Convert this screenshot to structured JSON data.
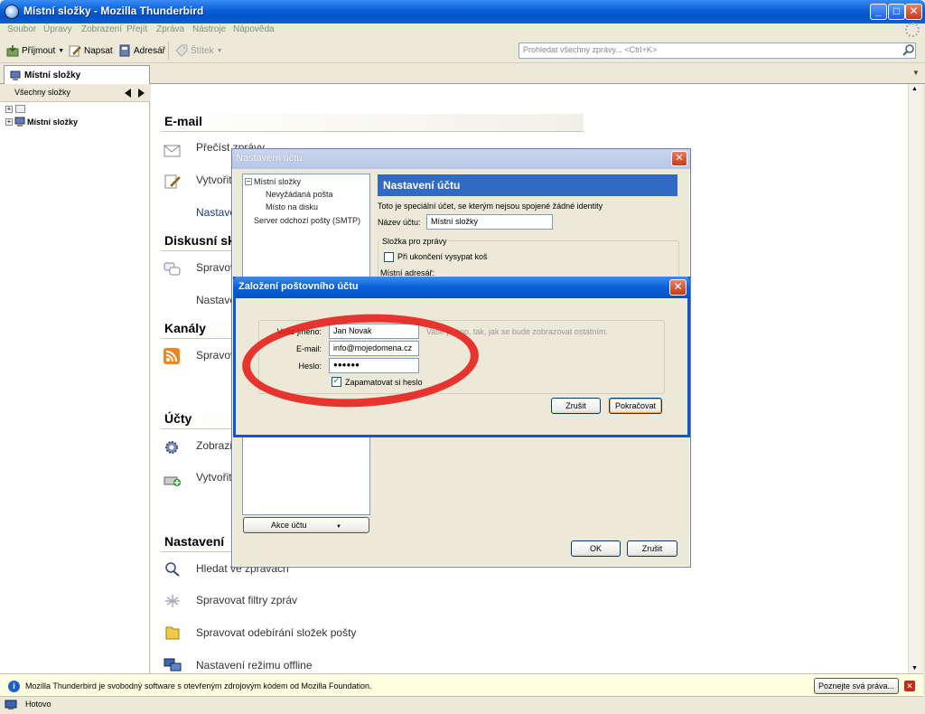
{
  "window": {
    "title": "Místní složky - Mozilla Thunderbird"
  },
  "menu": [
    "Soubor",
    "Úpravy",
    "Zobrazení",
    "Přejít",
    "Zpráva",
    "Nástroje",
    "Nápověda"
  ],
  "toolbar": {
    "get_mail": "Příjmout",
    "write": "Napsat",
    "address_book": "Adresář",
    "tag": "Štítek"
  },
  "search": {
    "placeholder": "Prohledat všechny zprávy... <Ctrl+K>"
  },
  "tab": {
    "label": "Místní složky"
  },
  "folder_pane": {
    "header": "Všechny složky",
    "root": "Místní složky"
  },
  "main": {
    "email_title": "E-mail",
    "email_items": [
      "Přečíst zprávy",
      "Vytvořit",
      "Nastave"
    ],
    "news_title": "Diskusní sk",
    "news_items": [
      "Spravov",
      "Nastave"
    ],
    "feeds_title": "Kanály",
    "feeds_items": [
      "Spravov"
    ],
    "accounts_title": "Účty",
    "accounts_items": [
      "Zobrazit",
      "Vytvořit"
    ],
    "settings_title": "Nastavení",
    "settings_items": [
      "Hledat ve zprávách",
      "Spravovat filtry zpráv",
      "Spravovat odebírání složek pošty",
      "Nastavení režimu offline"
    ]
  },
  "account_settings": {
    "title": "Nastavení účtu",
    "tree": [
      "Místní složky",
      "Nevyžádaná pošta",
      "Místo na disku",
      "Server odchozí pošty (SMTP)"
    ],
    "header": "Nastavení účtu",
    "description": "Toto je speciální účet, se kterým nejsou spojené žádné identity",
    "account_name_label": "Název účtu:",
    "account_name_value": "Místní složky",
    "message_storage_legend": "Složka pro zprávy",
    "empty_trash_label": "Při ukončení vysypat koš",
    "local_dir_label": "Místní adresář:",
    "account_actions": "Akce účtu",
    "ok": "OK",
    "cancel": "Zrušit"
  },
  "new_account": {
    "title": "Založení poštovního účtu",
    "name_label": "Vaše jméno:",
    "name_value": "Jan Novak",
    "name_hint": "Vaše jméno, tak, jak se bude zobrazovat ostatním.",
    "email_label": "E-mail:",
    "email_value": "info@mojedomena.cz",
    "password_label": "Heslo:",
    "password_value": "●●●●●●",
    "remember_label": "Zapamatovat si heslo",
    "cancel": "Zrušit",
    "continue": "Pokračovat"
  },
  "infobar": {
    "text": "Mozilla Thunderbird je svobodný software s otevřeným zdrojovým kódem od Mozilla Foundation.",
    "button": "Poznejte svá práva..."
  },
  "status": {
    "text": "Hotovo"
  },
  "colors": {
    "accent": "#316ac5",
    "title_blue": "#0a5fd8",
    "annotation_red": "#e8201c"
  }
}
